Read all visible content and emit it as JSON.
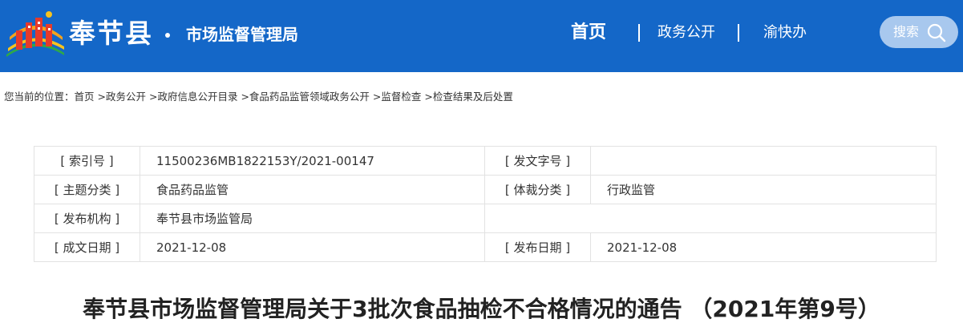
{
  "header": {
    "site_name": "奉节县",
    "bureau_name": "市场监督管理局",
    "nav": {
      "home": "首页",
      "gov_affairs": "政务公开",
      "yu_kuai_ban": "渝快办"
    },
    "search": {
      "label": "搜索"
    }
  },
  "breadcrumb": {
    "prefix": "您当前的位置：",
    "items": [
      "首页",
      "政务公开",
      "政府信息公开目录",
      "食品药品监管领域政务公开",
      "监督检查",
      "检查结果及后处置"
    ],
    "separator": " >"
  },
  "meta": {
    "index_no_label": "[ 索引号 ]",
    "index_no": "11500236MB1822153Y/2021-00147",
    "doc_no_label": "[ 发文字号 ]",
    "doc_no": "",
    "topic_label": "[ 主题分类 ]",
    "topic": "食品药品监管",
    "genre_label": "[ 体裁分类 ]",
    "genre": "行政监管",
    "issuer_label": "[ 发布机构 ]",
    "issuer": "奉节县市场监管局",
    "written_date_label": "[ 成文日期 ]",
    "written_date": "2021-12-08",
    "publish_date_label": "[ 发布日期 ]",
    "publish_date": "2021-12-08"
  },
  "article": {
    "title": "奉节县市场监督管理局关于3批次食品抽检不合格情况的通告 （2021年第9号）"
  },
  "colors": {
    "header_bg": "#1467c8",
    "search_bg": "#a8c8ee",
    "table_border": "#e2e2e2"
  },
  "icons": {
    "logo": "county-emblem-logo",
    "search": "search-icon"
  }
}
